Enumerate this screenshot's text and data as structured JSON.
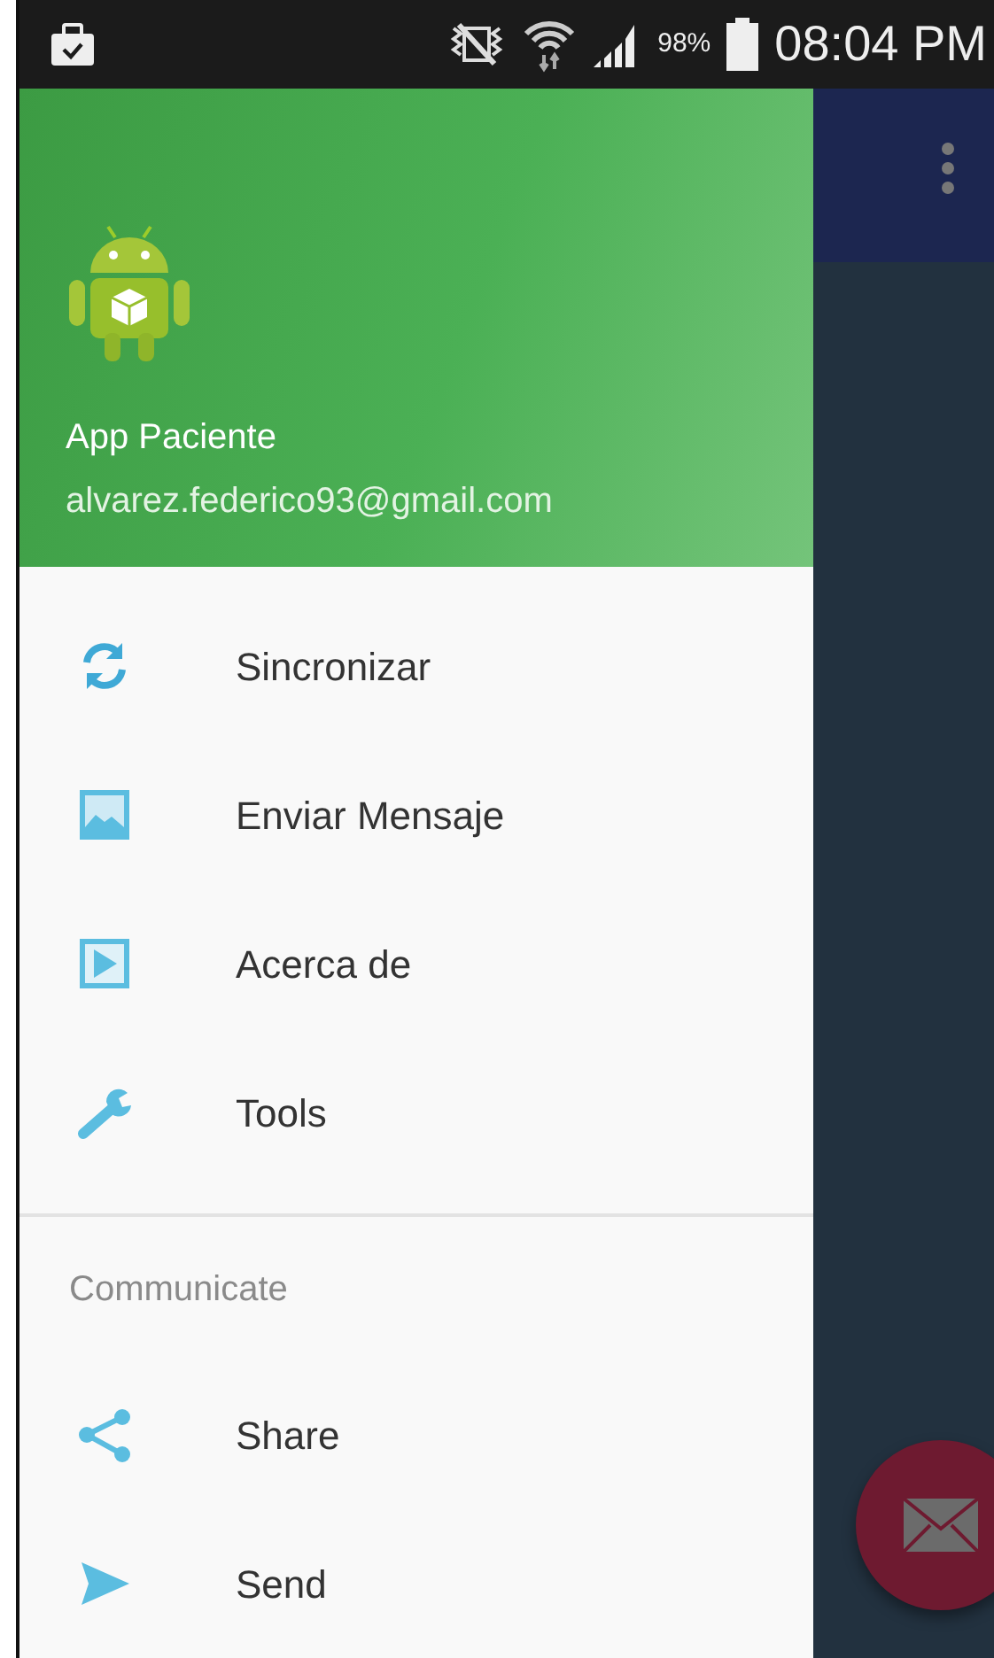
{
  "status_bar": {
    "battery_text": "98%",
    "time": "08:04 PM"
  },
  "drawer": {
    "header": {
      "title": "App Paciente",
      "email": "alvarez.federico93@gmail.com"
    },
    "items": [
      {
        "label": "Sincronizar"
      },
      {
        "label": "Enviar Mensaje"
      },
      {
        "label": "Acerca de"
      },
      {
        "label": "Tools"
      }
    ],
    "section": {
      "title": "Communicate",
      "items": [
        {
          "label": "Share"
        },
        {
          "label": "Send"
        }
      ]
    }
  }
}
